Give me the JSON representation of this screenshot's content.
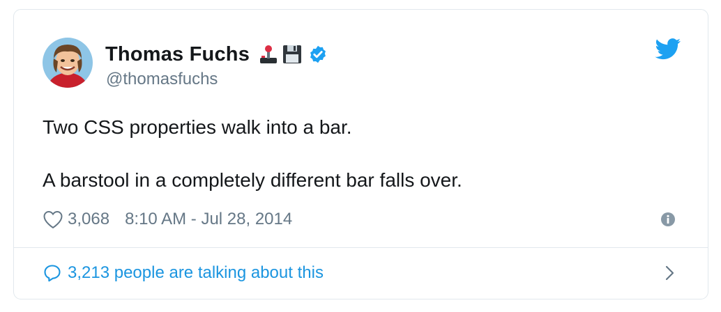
{
  "tweet": {
    "author_name": "Thomas Fuchs",
    "handle": "@thomasfuchs",
    "text_lines": [
      "Two CSS properties walk into a bar.",
      "A barstool in a completely different bar falls over."
    ],
    "likes": "3,068",
    "timestamp": "8:10 AM - Jul 28, 2014",
    "talking": "3,213 people are talking about this"
  },
  "icons": {
    "emoji_1": "joystick-icon",
    "emoji_2": "floppy-disk-icon",
    "verified": "verified-badge-icon",
    "brand": "twitter-bird-icon",
    "like": "heart-icon",
    "info": "info-icon",
    "reply": "speech-bubble-icon",
    "chevron": "chevron-right-icon"
  },
  "colors": {
    "text": "#14171a",
    "secondary": "#657786",
    "accent": "#1da1f2",
    "link": "#1b95e0",
    "border": "#e1e8ed"
  }
}
